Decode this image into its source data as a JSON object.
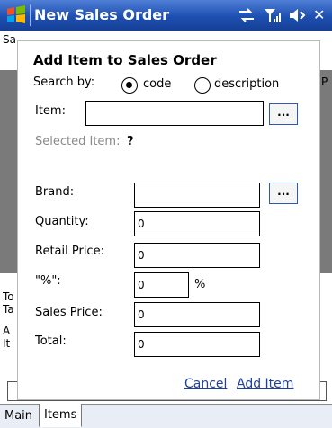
{
  "titlebar": {
    "title": "New Sales Order",
    "icons": [
      "windows-logo-icon",
      "connectivity-icon",
      "signal-icon",
      "volume-icon",
      "close-icon"
    ],
    "close_glyph": "✕"
  },
  "background_fragments": {
    "top_left": "Sa",
    "top_right": "P",
    "lines": [
      "To",
      "Ta",
      "A",
      "It"
    ]
  },
  "dialog": {
    "title": "Add Item to Sales Order",
    "search_by_label": "Search by:",
    "radio_code_label": "code",
    "radio_description_label": "description",
    "search_mode": "code",
    "item_label": "Item:",
    "item_value": "",
    "browse_label": "...",
    "selected_item_label": "Selected Item:",
    "selected_item_value": "?",
    "brand_label": "Brand:",
    "brand_value": "",
    "quantity_label": "Quantity:",
    "quantity_value": "0",
    "retail_price_label": "Retail Price:",
    "retail_price_value": "0",
    "discount_label": "\"%\":",
    "discount_value": "0",
    "percent_sign": "%",
    "sales_price_label": "Sales Price:",
    "sales_price_value": "0",
    "total_label": "Total:",
    "total_value": "0",
    "cancel_label": "Cancel",
    "add_item_label": "Add Item"
  },
  "tabs": [
    {
      "label": "Main",
      "active": false
    },
    {
      "label": "Items",
      "active": true
    }
  ],
  "colors": {
    "titlebar": "#1d4fb1",
    "link": "#1e3fa3",
    "overlay_grey": "#7a7a7a"
  }
}
